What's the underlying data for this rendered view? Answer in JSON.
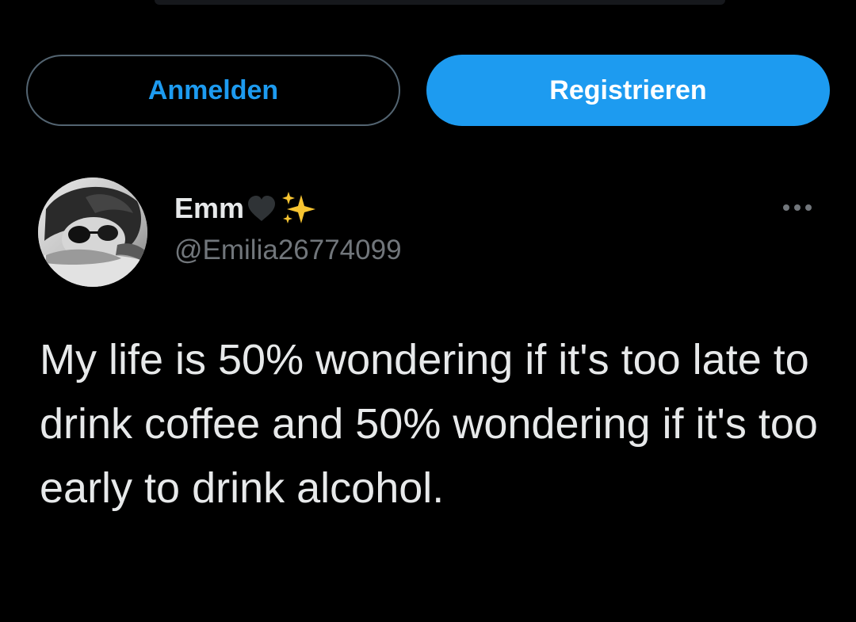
{
  "header": {
    "login_label": "Anmelden",
    "register_label": "Registrieren"
  },
  "tweet": {
    "user": {
      "display_name": "Emm",
      "name_emojis": [
        "black-heart-icon",
        "sparkles-icon"
      ],
      "handle": "@Emilia26774099",
      "avatar": "profile-photo"
    },
    "more_icon": "more-options-icon",
    "text": "My life is 50% wondering if it's too late to drink coffee and 50% wondering if it's too early to drink alcohol."
  },
  "colors": {
    "background": "#000000",
    "accent": "#1d9bf0",
    "text_primary": "#e7e9ea",
    "text_secondary": "#71767b",
    "outline": "#536471"
  }
}
